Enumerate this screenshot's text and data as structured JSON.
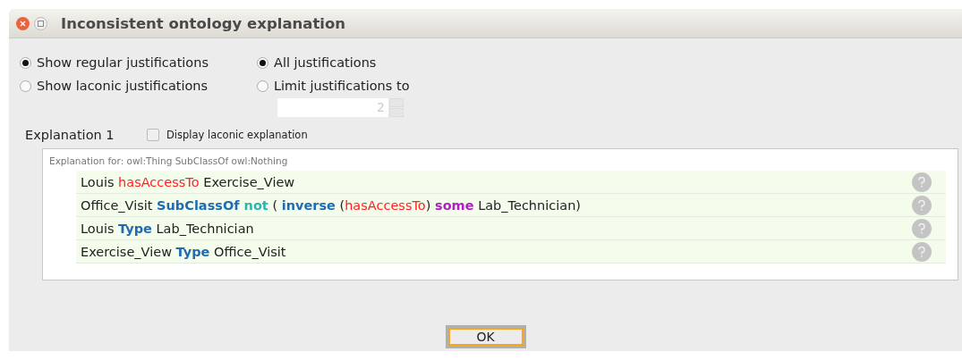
{
  "window": {
    "title": "Inconsistent ontology explanation"
  },
  "justification_type": [
    {
      "label": "Show regular justifications",
      "selected": true
    },
    {
      "label": "Show laconic justifications",
      "selected": false
    }
  ],
  "justification_limit": [
    {
      "label": "All justifications",
      "selected": true
    },
    {
      "label": "Limit justifications to",
      "selected": false
    }
  ],
  "limit_spinner": {
    "value": "2",
    "disabled": true
  },
  "explanation": {
    "title": "Explanation 1",
    "laconic_checkbox": {
      "label": "Display laconic explanation",
      "checked": false
    },
    "header": "Explanation for: owl:Thing SubClassOf owl:Nothing",
    "axioms": [
      {
        "tokens": [
          {
            "text": "Louis ",
            "kind": "plain"
          },
          {
            "text": "hasAccessTo",
            "kind": "property"
          },
          {
            "text": " Exercise_View",
            "kind": "plain"
          }
        ]
      },
      {
        "tokens": [
          {
            "text": "Office_Visit ",
            "kind": "plain"
          },
          {
            "text": "SubClassOf",
            "kind": "keyword"
          },
          {
            "text": " not",
            "kind": "negation"
          },
          {
            "text": " ( ",
            "kind": "plain"
          },
          {
            "text": "inverse",
            "kind": "keyword"
          },
          {
            "text": " (",
            "kind": "plain"
          },
          {
            "text": "hasAccessTo",
            "kind": "property"
          },
          {
            "text": ") ",
            "kind": "plain"
          },
          {
            "text": "some",
            "kind": "quantifier"
          },
          {
            "text": " Lab_Technician)",
            "kind": "plain"
          }
        ]
      },
      {
        "tokens": [
          {
            "text": "Louis ",
            "kind": "plain"
          },
          {
            "text": "Type",
            "kind": "keyword"
          },
          {
            "text": " Lab_Technician",
            "kind": "plain"
          }
        ]
      },
      {
        "tokens": [
          {
            "text": "Exercise_View ",
            "kind": "plain"
          },
          {
            "text": "Type",
            "kind": "keyword"
          },
          {
            "text": " Office_Visit",
            "kind": "plain"
          }
        ]
      }
    ]
  },
  "buttons": [
    {
      "label": "OK"
    }
  ]
}
